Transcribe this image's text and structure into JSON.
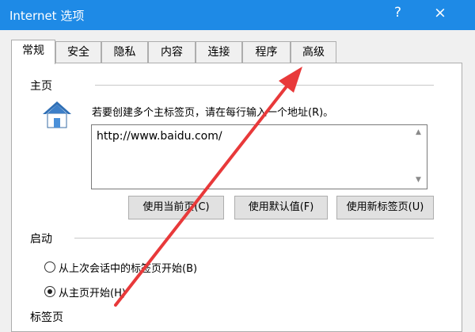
{
  "window": {
    "title": "Internet 选项",
    "help_glyph": "?",
    "close_glyph": "×"
  },
  "tabs": [
    {
      "label": "常规",
      "active": true
    },
    {
      "label": "安全"
    },
    {
      "label": "隐私"
    },
    {
      "label": "内容"
    },
    {
      "label": "连接"
    },
    {
      "label": "程序"
    },
    {
      "label": "高级"
    }
  ],
  "home": {
    "section_label": "主页",
    "description": "若要创建多个主标签页，请在每行输入一个地址(R)。",
    "url": "http://www.baidu.com/",
    "buttons": {
      "use_current": "使用当前页(C)",
      "use_default": "使用默认值(F)",
      "use_new_tab": "使用新标签页(U)"
    }
  },
  "startup": {
    "section_label": "启动",
    "options": [
      {
        "label": "从上次会话中的标签页开始(B)",
        "checked": false
      },
      {
        "label": "从主页开始(H)",
        "checked": true
      }
    ]
  },
  "tabs_section": {
    "section_label": "标签页"
  },
  "annotation": {
    "arrow_color": "#e8393a"
  }
}
